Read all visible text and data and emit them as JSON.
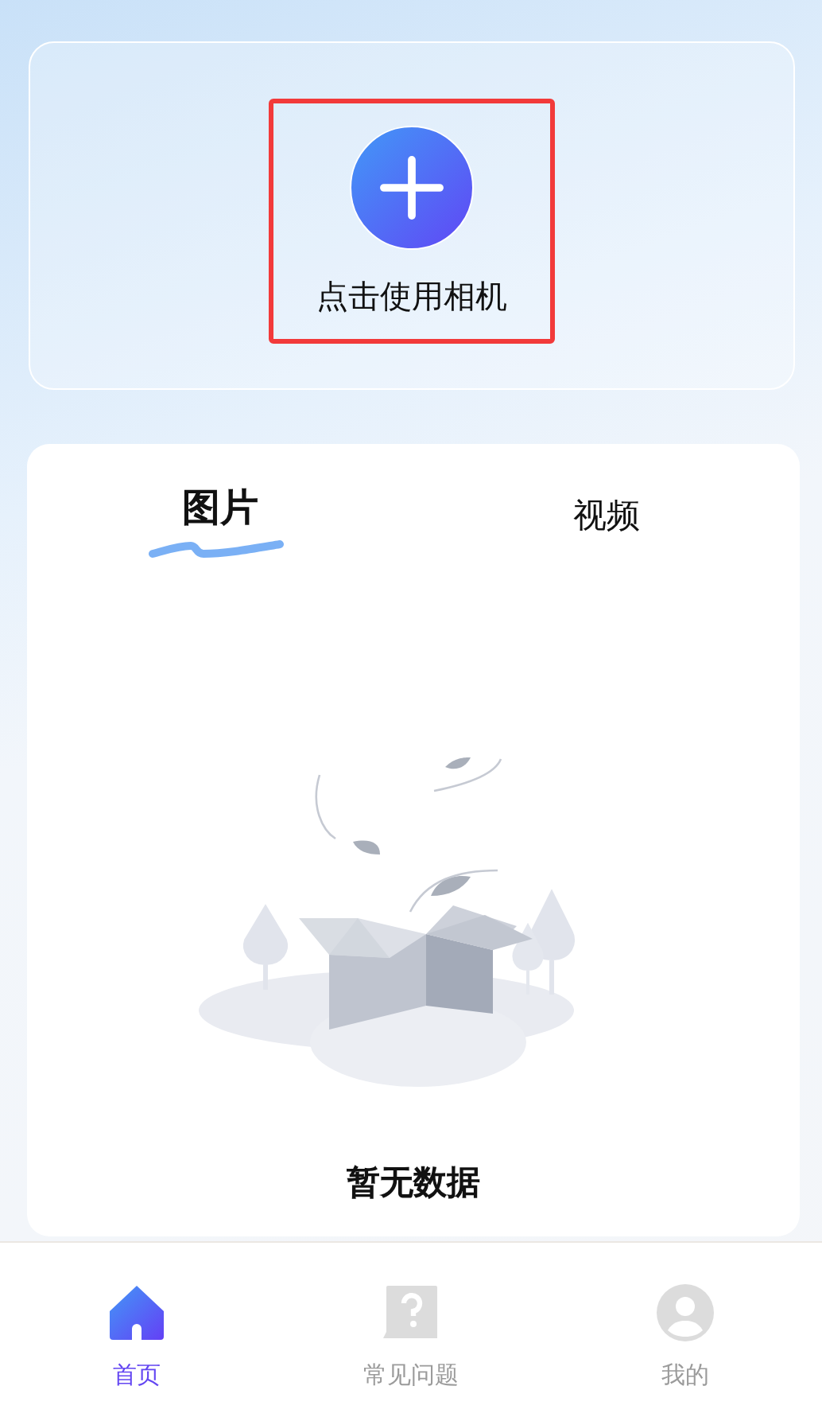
{
  "camera": {
    "label": "点击使用相机",
    "highlighted": true
  },
  "tabs": [
    {
      "label": "图片",
      "selected": true
    },
    {
      "label": "视频",
      "selected": false
    }
  ],
  "empty_state": {
    "message": "暂无数据"
  },
  "bottom_nav": [
    {
      "kind": "home",
      "label": "首页",
      "selected": true
    },
    {
      "kind": "faq",
      "label": "常见问题",
      "selected": false
    },
    {
      "kind": "profile",
      "label": "我的",
      "selected": false
    }
  ]
}
